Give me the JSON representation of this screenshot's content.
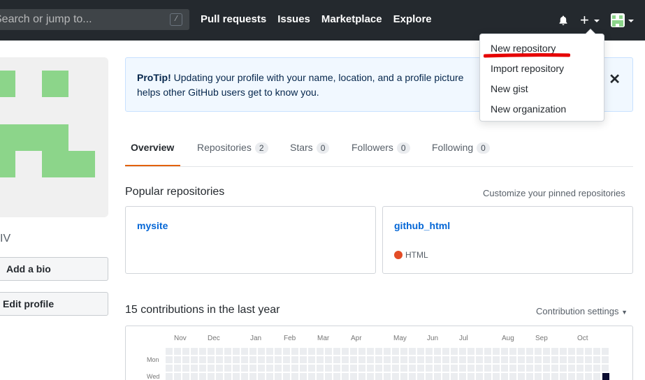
{
  "header": {
    "search_placeholder": "Search or jump to...",
    "search_hotkey": "/",
    "nav": [
      "Pull requests",
      "Issues",
      "Marketplace",
      "Explore"
    ],
    "icons": [
      "bell-icon",
      "plus-icon",
      "avatar"
    ]
  },
  "new_menu": {
    "items": [
      "New repository",
      "Import repository",
      "New gist",
      "New organization"
    ],
    "highlighted": "New repository",
    "highlight_color": "#e60000"
  },
  "protip": {
    "label": "ProTip!",
    "text": "Updating your profile with your name, location, and a profile picture helps other GitHub users get to know you.",
    "line2": "other GitHub users get to know you."
  },
  "sidebar": {
    "name_fragment": "IV",
    "add_bio": "Add a bio",
    "edit_profile": "Edit profile",
    "avatar_color": "#8cd58a"
  },
  "tabs": [
    {
      "label": "Overview",
      "count": null
    },
    {
      "label": "Repositories",
      "count": "2"
    },
    {
      "label": "Stars",
      "count": "0"
    },
    {
      "label": "Followers",
      "count": "0"
    },
    {
      "label": "Following",
      "count": "0"
    }
  ],
  "popular": {
    "title": "Popular repositories",
    "customize_link": "Customize your pinned repositories",
    "repos": [
      {
        "name": "mysite",
        "language": null,
        "language_color": null
      },
      {
        "name": "github_html",
        "language": "HTML",
        "language_color": "#e34c26"
      }
    ]
  },
  "contributions": {
    "title": "15 contributions in the last year",
    "settings": "Contribution settings",
    "months": [
      "Nov",
      "Dec",
      "Jan",
      "Feb",
      "Mar",
      "Apr",
      "May",
      "Jun",
      "Jul",
      "Aug",
      "Sep",
      "Oct"
    ],
    "days": [
      "Mon",
      "Wed"
    ],
    "empty_color": "#ebedf0",
    "filled_color": "#196127"
  }
}
